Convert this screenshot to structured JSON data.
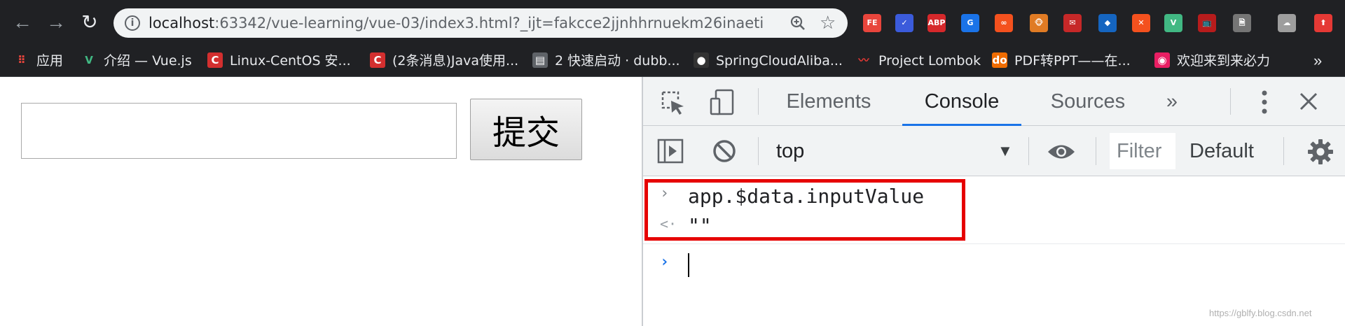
{
  "browser": {
    "url_host": "localhost",
    "url_rest": ":63342/vue-learning/vue-03/index3.html?_ijt=fakcce2jjnhhrnuekm26inaeti",
    "info_glyph": "i",
    "extensions": [
      "FE",
      "✓",
      "ABP",
      "G",
      "∞",
      "🐵",
      "✉",
      "◆",
      "✕",
      "V",
      "📺",
      "🗎",
      "☁",
      "⬆"
    ],
    "colors": {
      "bar": "#202124",
      "omnibox": "#f1f3f4"
    }
  },
  "bookmarks": {
    "items": [
      {
        "label": "应用",
        "icon": "apps-grid-icon"
      },
      {
        "label": "介绍 — Vue.js",
        "icon": "vue-icon"
      },
      {
        "label": "Linux-CentOS 安...",
        "icon": "csdn-icon"
      },
      {
        "label": "(2条消息)Java使用...",
        "icon": "csdn-icon"
      },
      {
        "label": "2 快速启动 · dubb...",
        "icon": "book-icon"
      },
      {
        "label": "SpringCloudAliba...",
        "icon": "github-icon"
      },
      {
        "label": "Project Lombok",
        "icon": "chili-icon"
      },
      {
        "label": "PDF转PPT——在...",
        "icon": "do-icon"
      },
      {
        "label": "欢迎来到来必力",
        "icon": "livere-icon"
      }
    ],
    "more": "»"
  },
  "page": {
    "input_value": "",
    "submit_label": "提交"
  },
  "devtools": {
    "tabs": [
      {
        "label": "Elements",
        "active": false
      },
      {
        "label": "Console",
        "active": true
      },
      {
        "label": "Sources",
        "active": false
      }
    ],
    "more_tabs": "»",
    "context": "top",
    "filter_placeholder": "Filter",
    "levels": "Default",
    "console": {
      "command": "app.$data.inputValue",
      "result": "\"\""
    },
    "colors": {
      "accent": "#1a73e8",
      "highlight": "#e60000"
    }
  },
  "watermark": "https://gblfy.blog.csdn.net"
}
